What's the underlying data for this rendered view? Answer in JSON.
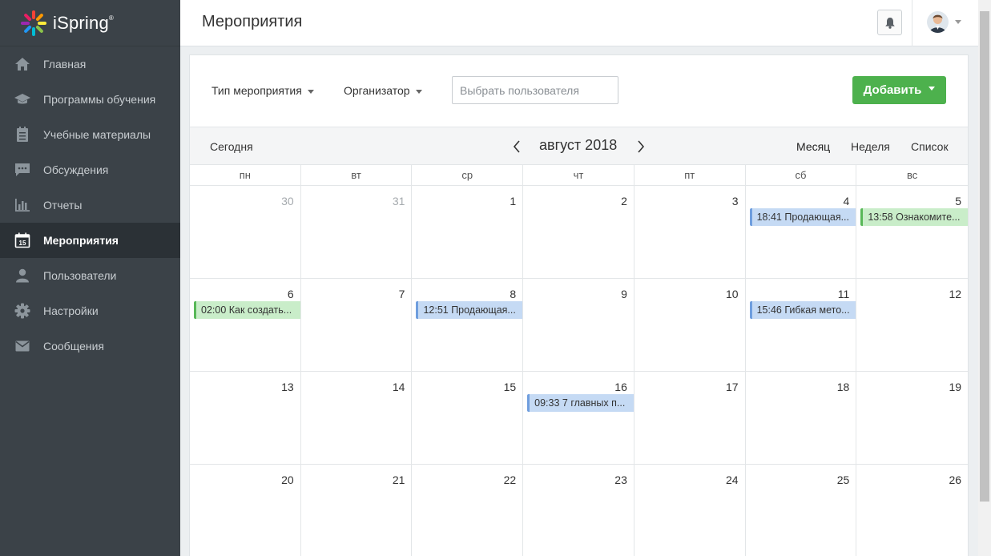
{
  "brand": {
    "name": "iSpring"
  },
  "sidebar": {
    "items": [
      {
        "label": "Главная",
        "icon": "home-icon"
      },
      {
        "label": "Программы обучения",
        "icon": "graduation-cap-icon"
      },
      {
        "label": "Учебные материалы",
        "icon": "materials-icon"
      },
      {
        "label": "Обсуждения",
        "icon": "chat-icon"
      },
      {
        "label": "Отчеты",
        "icon": "bar-chart-icon"
      },
      {
        "label": "Мероприятия",
        "icon": "calendar-icon",
        "active": true
      },
      {
        "label": "Пользователи",
        "icon": "user-icon"
      },
      {
        "label": "Настройки",
        "icon": "gear-icon"
      },
      {
        "label": "Сообщения",
        "icon": "envelope-icon"
      }
    ]
  },
  "header": {
    "title": "Мероприятия"
  },
  "filters": {
    "event_type": "Тип мероприятия",
    "organizer": "Организатор",
    "user_placeholder": "Выбрать пользователя",
    "add_label": "Добавить"
  },
  "toolbar": {
    "today": "Сегодня",
    "month_title": "август 2018",
    "views": {
      "month": "Месяц",
      "week": "Неделя",
      "list": "Список"
    }
  },
  "calendar": {
    "weekdays": [
      "пн",
      "вт",
      "ср",
      "чт",
      "пт",
      "сб",
      "вс"
    ],
    "weeks": [
      [
        {
          "day": "30",
          "other": true
        },
        {
          "day": "31",
          "other": true
        },
        {
          "day": "1"
        },
        {
          "day": "2"
        },
        {
          "day": "3"
        },
        {
          "day": "4",
          "event": {
            "text": "18:41 Продающая...",
            "color": "blue"
          }
        },
        {
          "day": "5",
          "event": {
            "text": "13:58 Ознакомите...",
            "color": "green"
          }
        }
      ],
      [
        {
          "day": "6",
          "event": {
            "text": "02:00 Как создать...",
            "color": "green"
          }
        },
        {
          "day": "7"
        },
        {
          "day": "8",
          "event": {
            "text": "12:51 Продающая...",
            "color": "blue"
          }
        },
        {
          "day": "9"
        },
        {
          "day": "10"
        },
        {
          "day": "11",
          "event": {
            "text": "15:46 Гибкая мето...",
            "color": "blue"
          }
        },
        {
          "day": "12"
        }
      ],
      [
        {
          "day": "13"
        },
        {
          "day": "14"
        },
        {
          "day": "15"
        },
        {
          "day": "16",
          "event": {
            "text": "09:33 7 главных п...",
            "color": "blue"
          }
        },
        {
          "day": "17"
        },
        {
          "day": "18"
        },
        {
          "day": "19"
        }
      ],
      [
        {
          "day": "20"
        },
        {
          "day": "21"
        },
        {
          "day": "22"
        },
        {
          "day": "23"
        },
        {
          "day": "24"
        },
        {
          "day": "25"
        },
        {
          "day": "26"
        }
      ]
    ]
  },
  "colors": {
    "sidebar_bg": "#3b4248",
    "accent_green": "#4db14d",
    "event_blue": "#c5daf4",
    "event_green": "#c9edc9"
  }
}
